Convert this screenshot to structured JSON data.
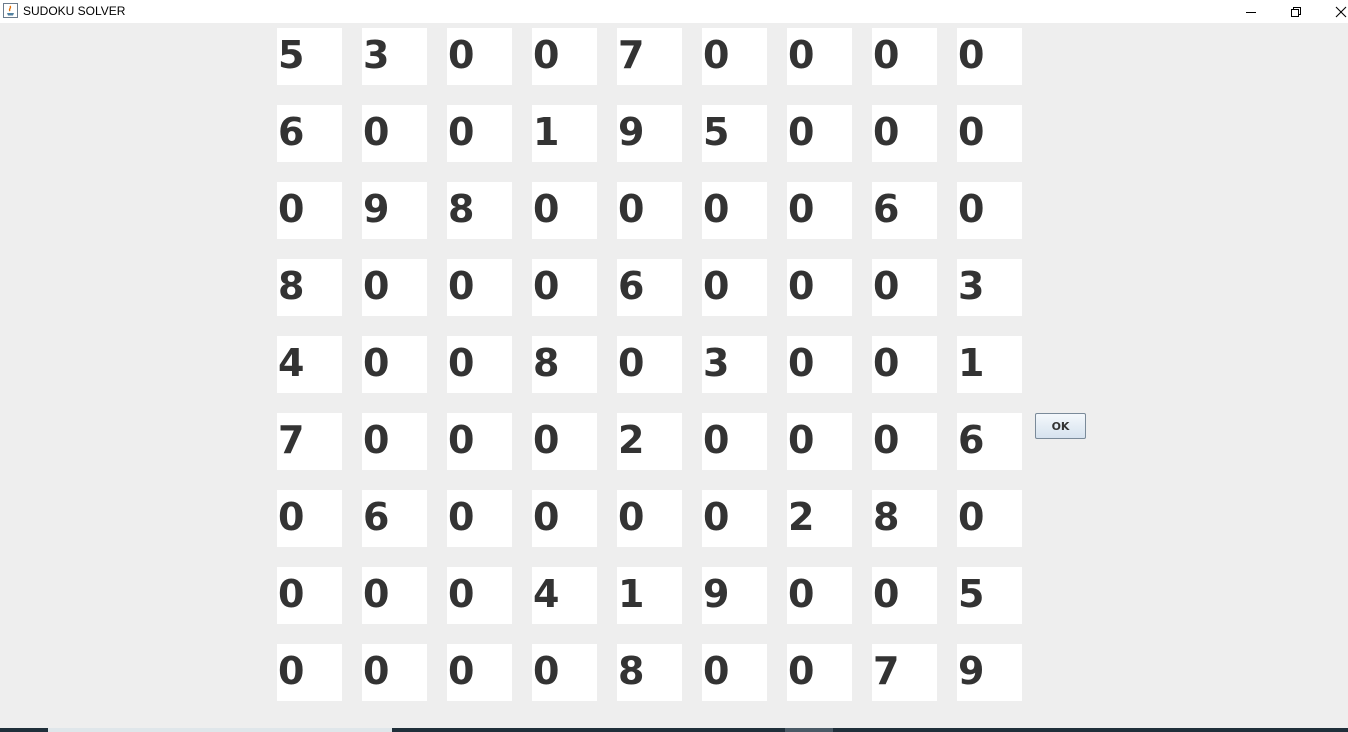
{
  "window": {
    "title": "SUDOKU SOLVER",
    "controls": {
      "minimize_icon": "minimize-icon",
      "restore_icon": "restore-icon",
      "close_icon": "close-icon"
    }
  },
  "grid": {
    "rows": [
      [
        "5",
        "3",
        "0",
        "0",
        "7",
        "0",
        "0",
        "0",
        "0"
      ],
      [
        "6",
        "0",
        "0",
        "1",
        "9",
        "5",
        "0",
        "0",
        "0"
      ],
      [
        "0",
        "9",
        "8",
        "0",
        "0",
        "0",
        "0",
        "6",
        "0"
      ],
      [
        "8",
        "0",
        "0",
        "0",
        "6",
        "0",
        "0",
        "0",
        "3"
      ],
      [
        "4",
        "0",
        "0",
        "8",
        "0",
        "3",
        "0",
        "0",
        "1"
      ],
      [
        "7",
        "0",
        "0",
        "0",
        "2",
        "0",
        "0",
        "0",
        "6"
      ],
      [
        "0",
        "6",
        "0",
        "0",
        "0",
        "0",
        "2",
        "8",
        "0"
      ],
      [
        "0",
        "0",
        "0",
        "4",
        "1",
        "9",
        "0",
        "0",
        "5"
      ],
      [
        "0",
        "0",
        "0",
        "0",
        "8",
        "0",
        "0",
        "7",
        "9"
      ]
    ]
  },
  "actions": {
    "ok_label": "OK"
  },
  "colors": {
    "background": "#eeeeee",
    "cell_background": "#ffffff",
    "cell_text": "#333333"
  }
}
